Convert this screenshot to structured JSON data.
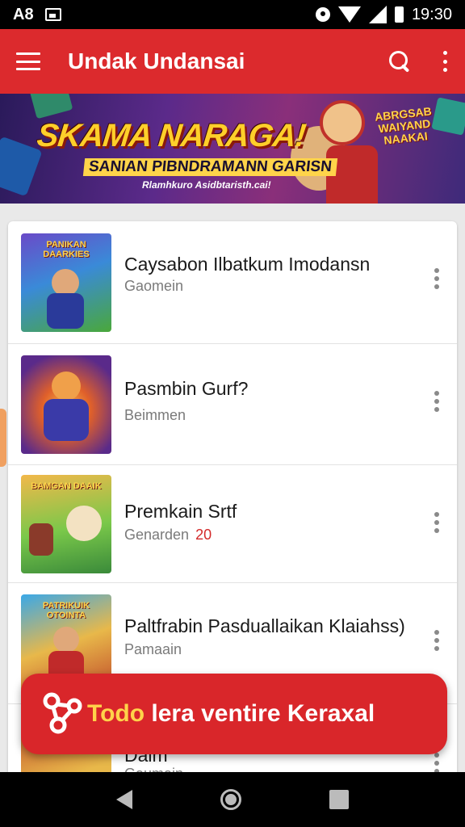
{
  "status_bar": {
    "left_text": "A8",
    "time": "19:30"
  },
  "app_bar": {
    "title": "Undak Undansai",
    "icons": [
      "menu-icon",
      "search-icon",
      "more-vert-icon"
    ]
  },
  "banner": {
    "title": "SKAMA NARAGA!",
    "subtitle": "SANIAN PIBNDRAMANN GARISN",
    "tagline": "Rlamhkuro Asidbtaristh.cai!",
    "side_text": "ABRGSAB WAIYAND NAAKAI"
  },
  "list": {
    "items": [
      {
        "title": "Caysabon Ilbatkum Imodansn",
        "subtitle": "Gaomein",
        "count": "",
        "thumb_caption": "PANIKAN DAARKIES"
      },
      {
        "title": "Pasmbin Gurf?",
        "subtitle": "Beimmen",
        "count": "",
        "thumb_caption": ""
      },
      {
        "title": "Premkain Srtf",
        "subtitle": "Genarden",
        "count": "20",
        "thumb_caption": "BAMGAN DAAIK"
      },
      {
        "title": "Paltfrabin Pasduallaikan Klaiahss)",
        "subtitle": "Pamaain",
        "count": "",
        "thumb_caption": "PATRIKUIK OTOINTA"
      },
      {
        "title": "Dalm",
        "subtitle": "Gaumain",
        "count": "",
        "thumb_caption": ""
      }
    ]
  },
  "fab": {
    "label_highlight": "Todo",
    "label_rest": " lera ventire Keraxal"
  },
  "colors": {
    "accent": "#dc2a2d",
    "fab": "#d9262a",
    "count_red": "#d32a2a"
  }
}
